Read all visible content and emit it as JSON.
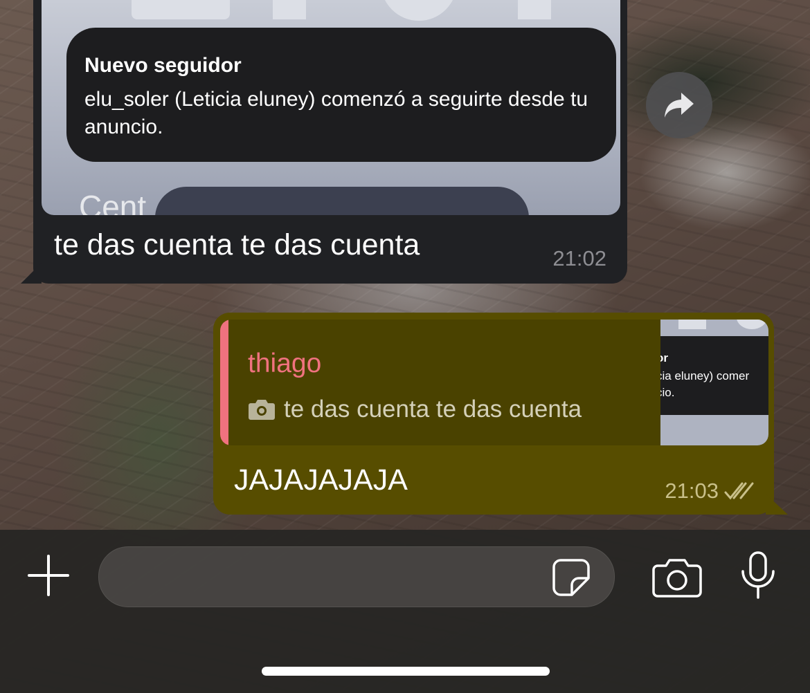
{
  "incoming_message": {
    "image": {
      "notification_title": "Nuevo seguidor",
      "notification_body": "elu_soler (Leticia eluney) comenzó a seguirte desde tu anuncio.",
      "background_text": "Cent"
    },
    "text": "te das cuenta te das cuenta",
    "time": "21:02"
  },
  "forward_button": {
    "icon": "forward-arrow-icon"
  },
  "outgoing_message": {
    "reply": {
      "sender": "thiago",
      "text": "te das cuenta te das cuenta",
      "media_icon": "camera-icon",
      "thumb_lines": [
        "or",
        "cia eluney) comer",
        "cio."
      ]
    },
    "text": "JAJAJAJAJA",
    "time": "21:03",
    "status_icon": "double-check-icon"
  },
  "input_bar": {
    "attach_icon": "plus-icon",
    "message_field_placeholder": "",
    "sticker_icon": "sticker-icon",
    "camera_icon": "camera-icon",
    "mic_icon": "microphone-icon"
  },
  "colors": {
    "incoming_bubble": "#202124",
    "outgoing_bubble": "#574d00",
    "reply_accent": "#f0727f"
  }
}
